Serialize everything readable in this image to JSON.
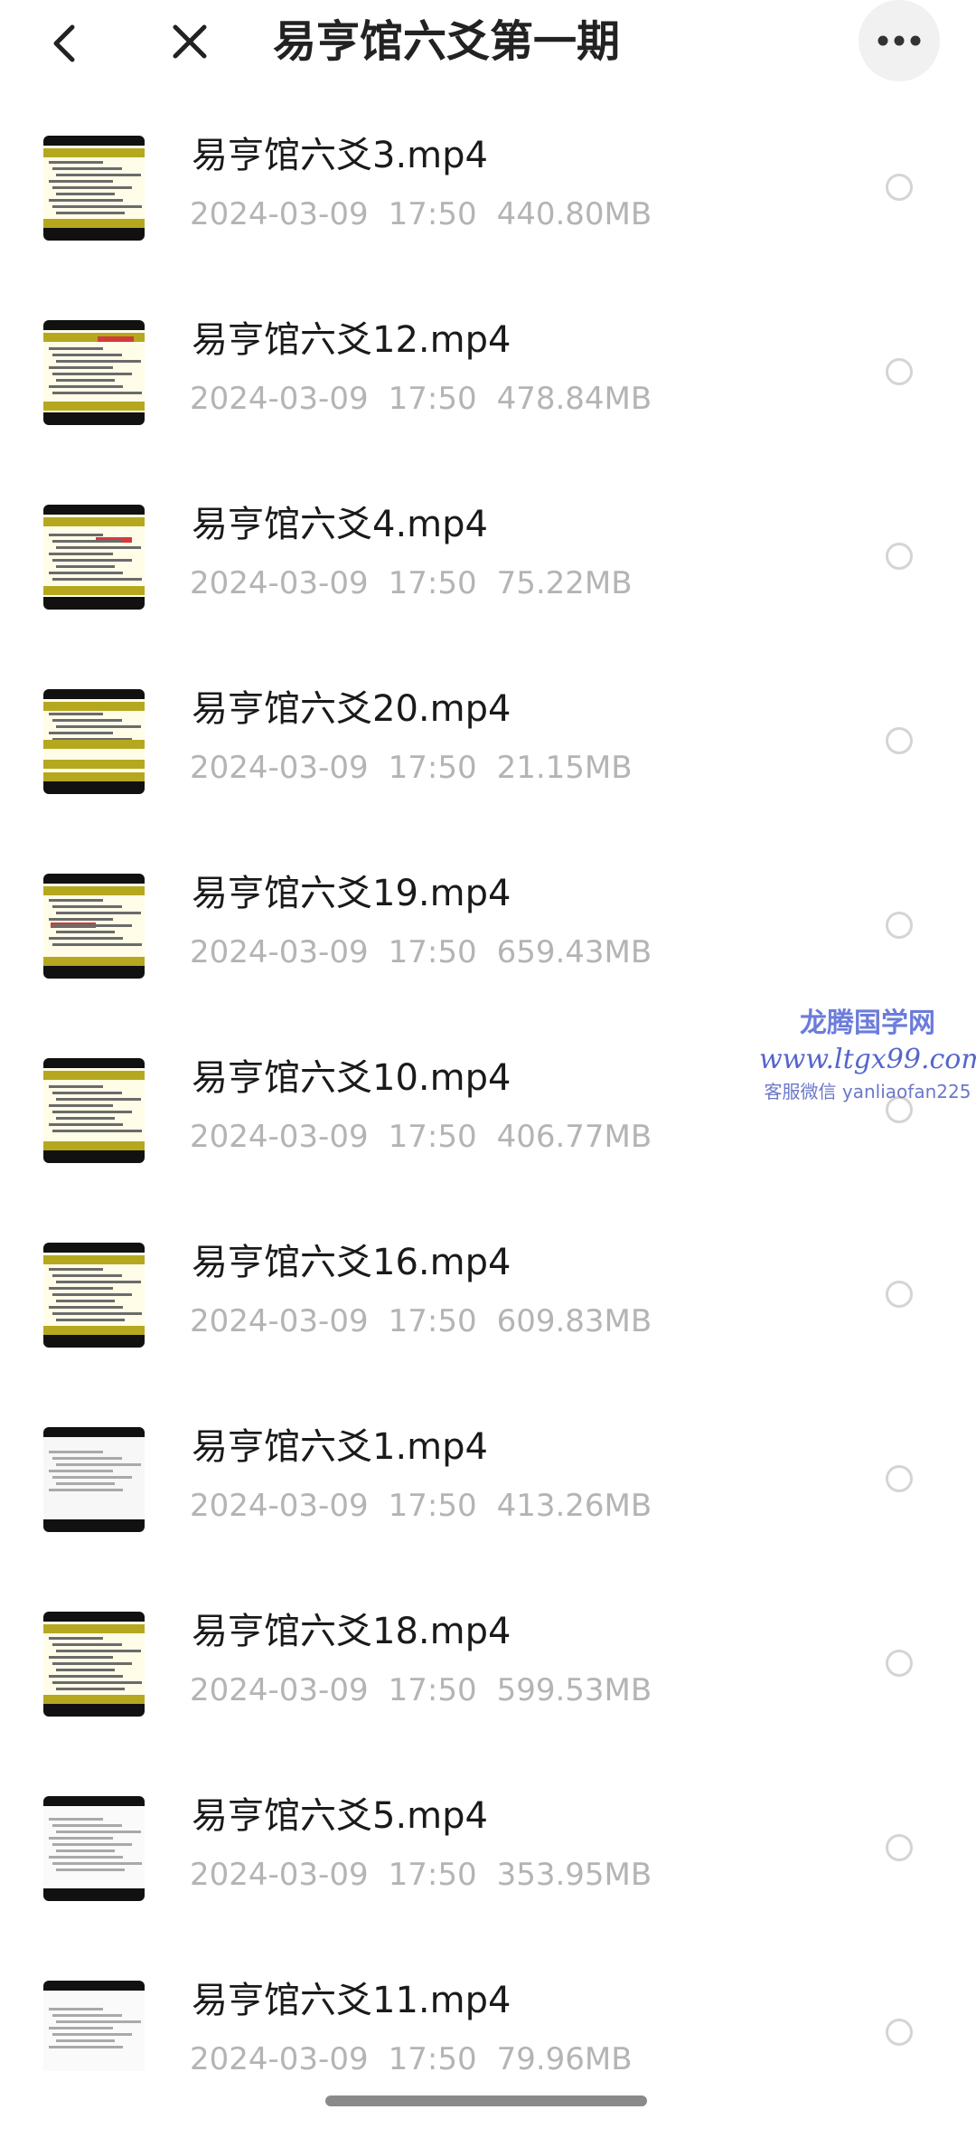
{
  "header": {
    "back_icon": "chevron-left-icon",
    "close_icon": "close-icon",
    "title": "易亨馆六爻第一期",
    "more_icon": "more-horizontal-icon"
  },
  "files": [
    {
      "name": "易亨馆六爻3.mp4",
      "date": "2024-03-09",
      "time": "17:50",
      "size": "440.80MB"
    },
    {
      "name": "易亨馆六爻12.mp4",
      "date": "2024-03-09",
      "time": "17:50",
      "size": "478.84MB"
    },
    {
      "name": "易亨馆六爻4.mp4",
      "date": "2024-03-09",
      "time": "17:50",
      "size": "75.22MB"
    },
    {
      "name": "易亨馆六爻20.mp4",
      "date": "2024-03-09",
      "time": "17:50",
      "size": "21.15MB"
    },
    {
      "name": "易亨馆六爻19.mp4",
      "date": "2024-03-09",
      "time": "17:50",
      "size": "659.43MB"
    },
    {
      "name": "易亨馆六爻10.mp4",
      "date": "2024-03-09",
      "time": "17:50",
      "size": "406.77MB"
    },
    {
      "name": "易亨馆六爻16.mp4",
      "date": "2024-03-09",
      "time": "17:50",
      "size": "609.83MB"
    },
    {
      "name": "易亨馆六爻1.mp4",
      "date": "2024-03-09",
      "time": "17:50",
      "size": "413.26MB"
    },
    {
      "name": "易亨馆六爻18.mp4",
      "date": "2024-03-09",
      "time": "17:50",
      "size": "599.53MB"
    },
    {
      "name": "易亨馆六爻5.mp4",
      "date": "2024-03-09",
      "time": "17:50",
      "size": "353.95MB"
    },
    {
      "name": "易亨馆六爻11.mp4",
      "date": "2024-03-09",
      "time": "17:50",
      "size": "79.96MB"
    }
  ],
  "watermark": {
    "line1": "龙腾国学网",
    "line2": "www.ltgx99.com",
    "line3": "客服微信 yanliaofan225"
  },
  "colors": {
    "title": "#222222",
    "file_name": "#1a1a1a",
    "meta": "#b4b4b4",
    "radio_border": "#d4d4d4",
    "watermark": "#6c7cdb",
    "thumbnail_band": "#b5a81f"
  }
}
